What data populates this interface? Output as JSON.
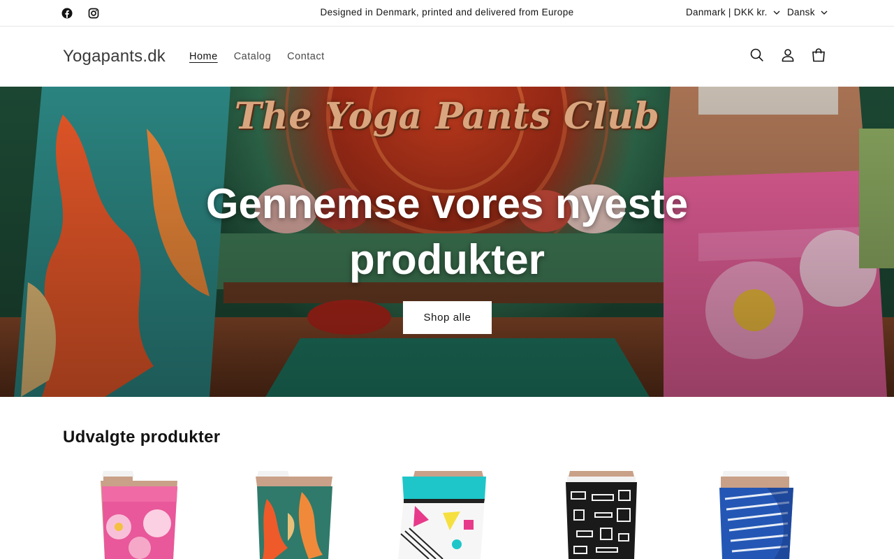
{
  "announcement": {
    "text": "Designed in Denmark, printed and delivered from Europe",
    "social": [
      {
        "icon": "facebook-icon"
      },
      {
        "icon": "instagram-icon"
      }
    ],
    "country_selector": "Danmark | DKK kr.",
    "language_selector": "Dansk"
  },
  "header": {
    "logo": "Yogapants.dk",
    "nav": [
      {
        "label": "Home",
        "active": true
      },
      {
        "label": "Catalog",
        "active": false
      },
      {
        "label": "Contact",
        "active": false
      }
    ],
    "icons": [
      "search-icon",
      "account-icon",
      "cart-icon"
    ]
  },
  "hero": {
    "banner_title": "The Yoga Pants Club",
    "heading": "Gennemse vores nyeste produkter",
    "button": "Shop alle"
  },
  "featured": {
    "title": "Udvalgte produkter",
    "products": [
      {
        "pattern": "pink-hibiscus",
        "waistband": "#ea5a9c"
      },
      {
        "pattern": "orange-leaves",
        "waistband": "#2f7a6a"
      },
      {
        "pattern": "memphis-abstract",
        "waistband": "#1ec6c9"
      },
      {
        "pattern": "black-white-tribal",
        "waistband": "#1a1a1a"
      },
      {
        "pattern": "blue-white-stripes",
        "waistband": "#2457b5"
      }
    ]
  }
}
